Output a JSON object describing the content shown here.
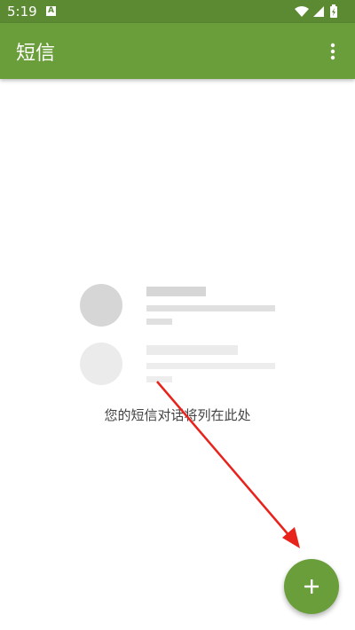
{
  "status_bar": {
    "time": "5:19",
    "notification_icon": "a-icon",
    "icons": [
      "wifi-icon",
      "cellular-signal-icon",
      "battery-icon"
    ]
  },
  "app_bar": {
    "title": "短信",
    "menu_icon": "more-vert-icon"
  },
  "empty_state": {
    "message": "您的短信对话将列在此处"
  },
  "fab": {
    "icon": "plus-icon"
  },
  "colors": {
    "status_bar": "#5b8a32",
    "app_bar": "#6a9e3a",
    "fab": "#6a9e3a",
    "annotation_arrow": "#e8231c"
  }
}
